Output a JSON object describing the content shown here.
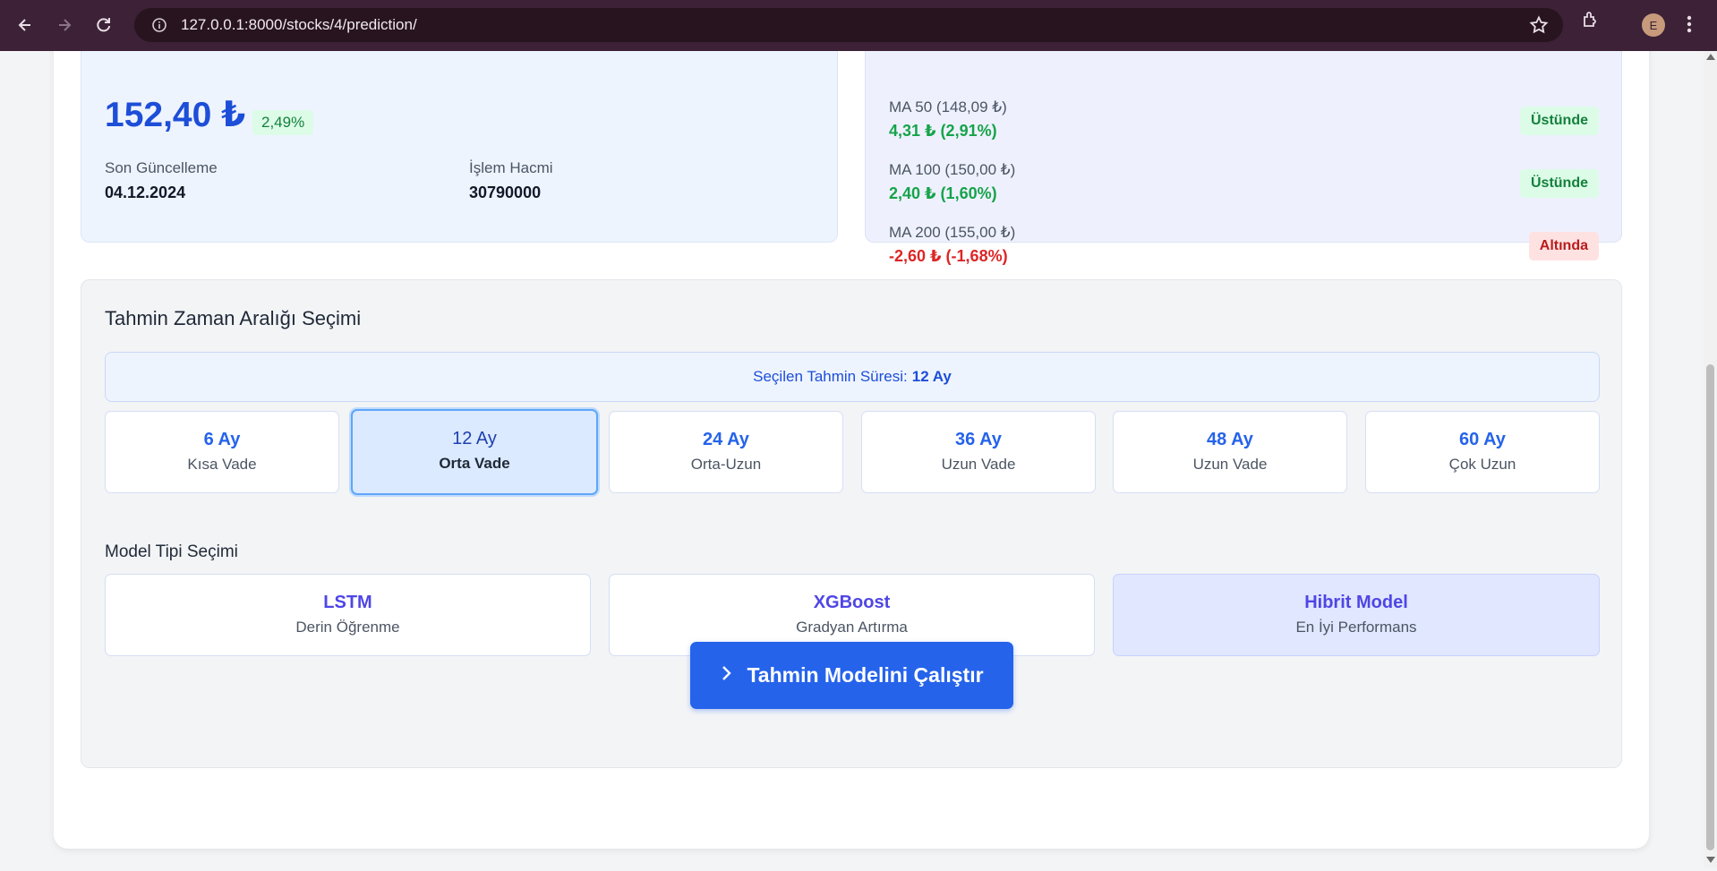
{
  "browser": {
    "url": "127.0.0.1:8000/stocks/4/prediction/",
    "profile_initial": "E"
  },
  "stock": {
    "price": "152,40 ₺",
    "change_pct": "2,49%",
    "last_update_label": "Son Güncelleme",
    "last_update": "04.12.2024",
    "volume_label": "İşlem Hacmi",
    "volume": "30790000"
  },
  "moving_averages": [
    {
      "name": "MA 50 (148,09 ₺)",
      "delta": "4,31 ₺ (2,91%)",
      "direction": "up",
      "status": "Üstünde"
    },
    {
      "name": "MA 100 (150,00 ₺)",
      "delta": "2,40 ₺ (1,60%)",
      "direction": "up",
      "status": "Üstünde"
    },
    {
      "name": "MA 200 (155,00 ₺)",
      "delta": "-2,60 ₺ (-1,68%)",
      "direction": "down",
      "status": "Altında"
    }
  ],
  "prediction": {
    "section_title": "Tahmin Zaman Aralığı Seçimi",
    "selected_label": "Seçilen Tahmin Süresi:",
    "selected_value": "12 Ay",
    "periods": [
      {
        "title": "6 Ay",
        "sub": "Kısa Vade",
        "active": false
      },
      {
        "title": "12 Ay",
        "sub": "Orta Vade",
        "active": true
      },
      {
        "title": "24 Ay",
        "sub": "Orta-Uzun",
        "active": false
      },
      {
        "title": "36 Ay",
        "sub": "Uzun Vade",
        "active": false
      },
      {
        "title": "48 Ay",
        "sub": "Uzun Vade",
        "active": false
      },
      {
        "title": "60 Ay",
        "sub": "Çok Uzun",
        "active": false
      }
    ],
    "model_section_title": "Model Tipi Seçimi",
    "models": [
      {
        "title": "LSTM",
        "sub": "Derin Öğrenme",
        "active": false
      },
      {
        "title": "XGBoost",
        "sub": "Gradyan Artırma",
        "active": false
      },
      {
        "title": "Hibrit Model",
        "sub": "En İyi Performans",
        "active": true
      }
    ],
    "run_button": "Tahmin Modelini Çalıştır"
  },
  "colors": {
    "primary": "#2563eb",
    "positive": "#16a34a",
    "negative": "#dc2626",
    "chrome": "#3c2137"
  },
  "icons": [
    "back-arrow-icon",
    "forward-arrow-icon",
    "reload-icon",
    "site-info-icon",
    "bookmark-star-icon",
    "extensions-icon",
    "kebab-menu-icon",
    "chevron-right-icon"
  ]
}
